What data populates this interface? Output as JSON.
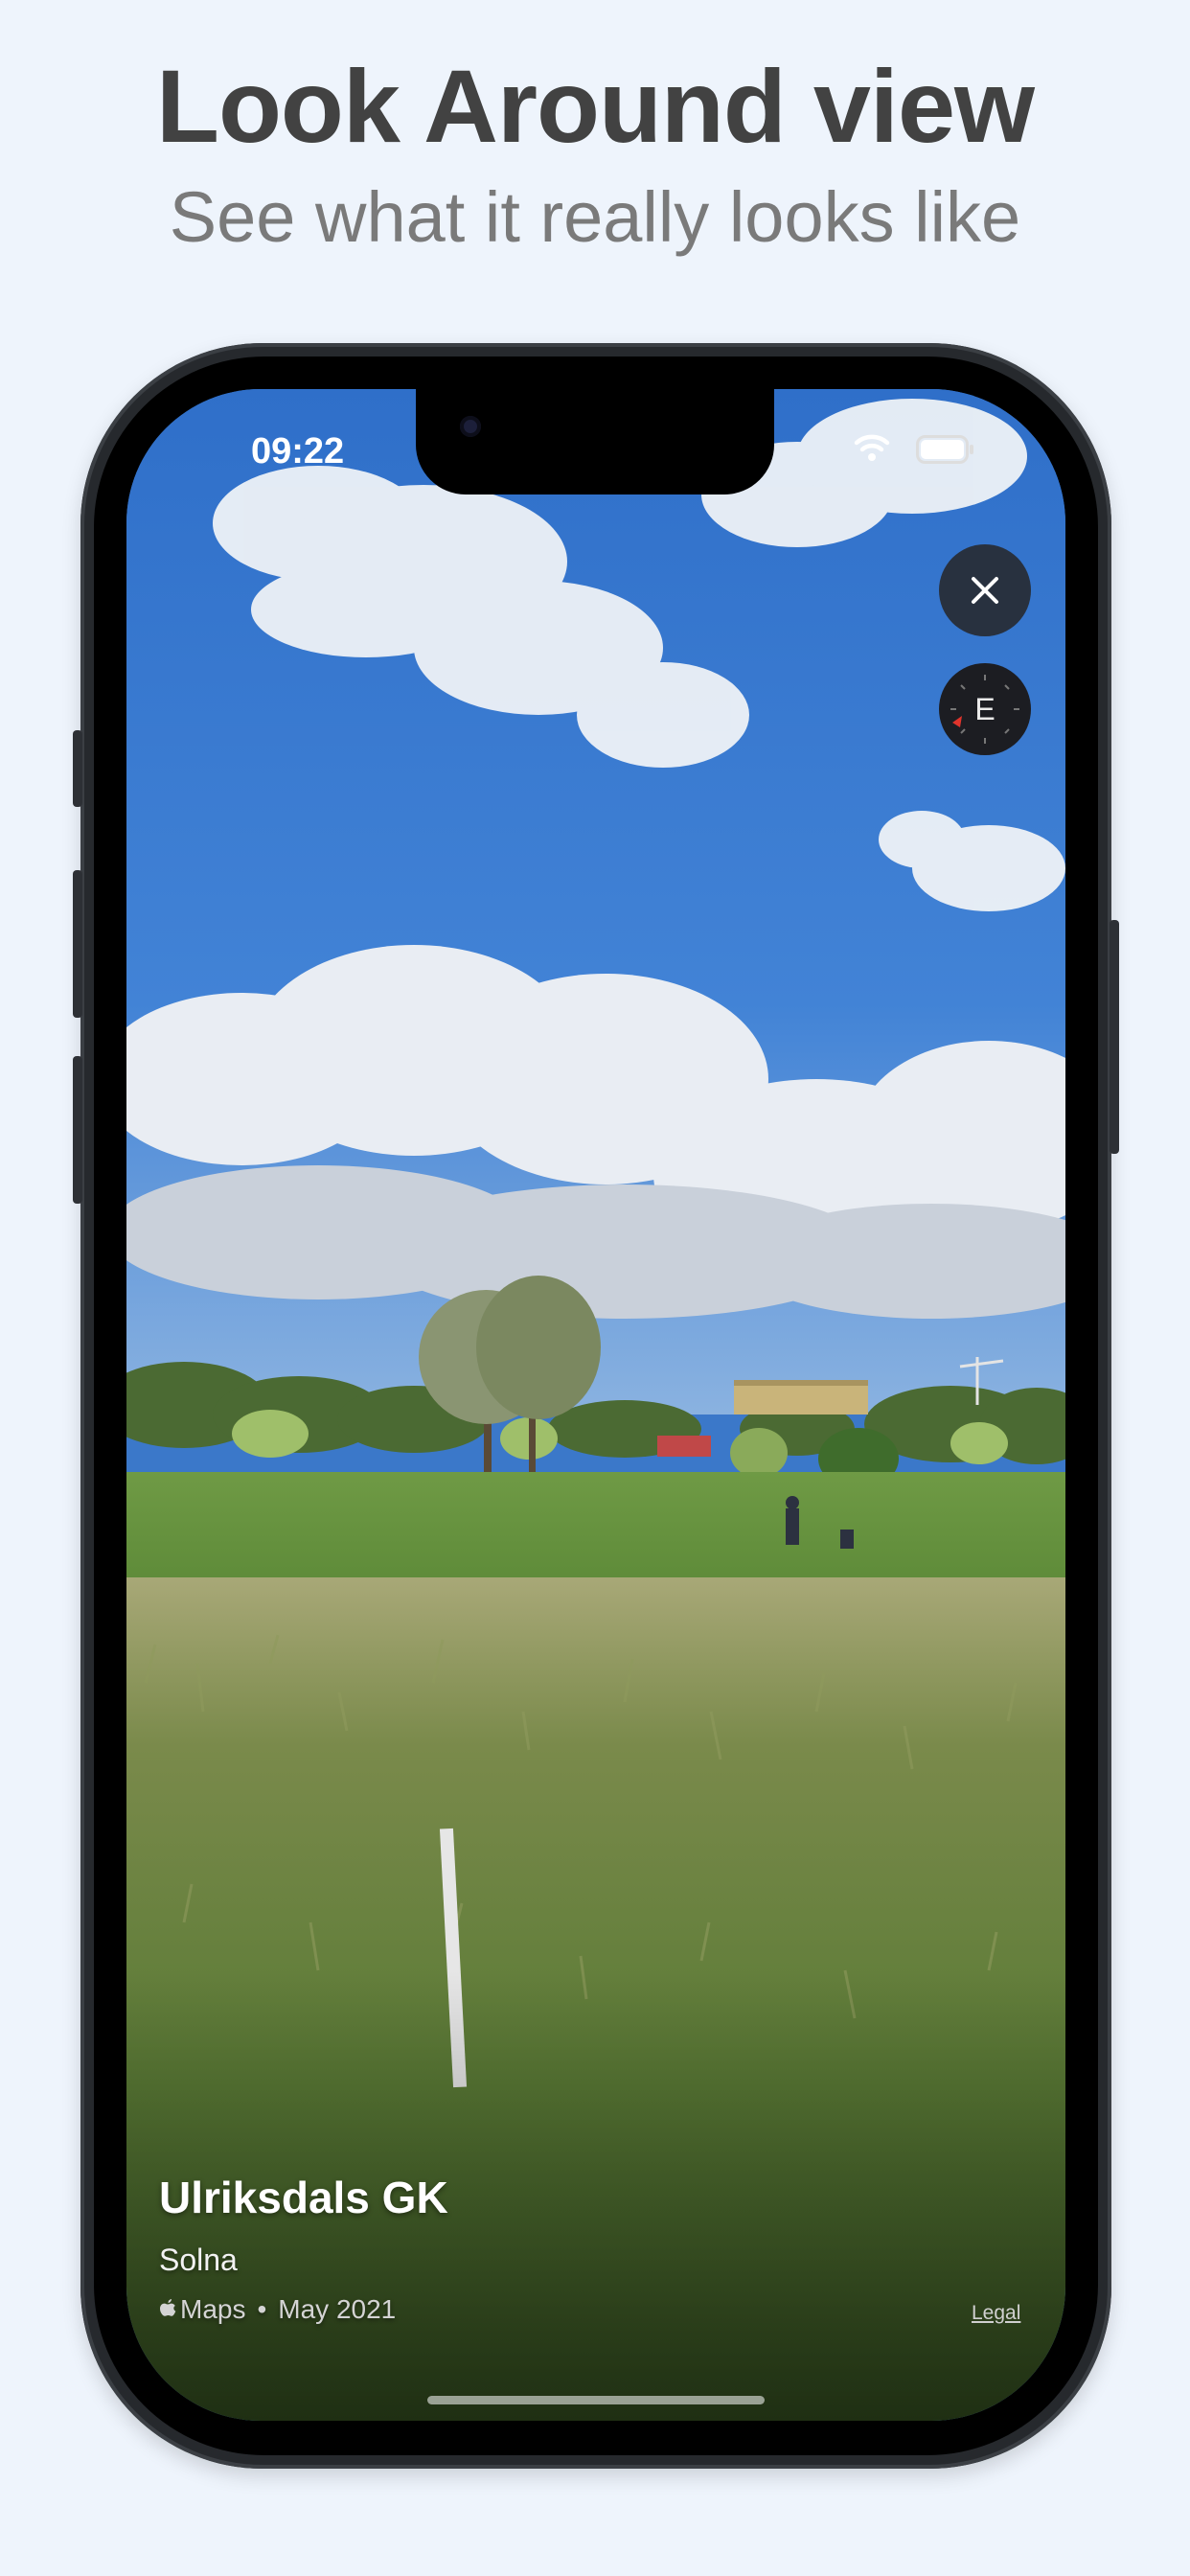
{
  "promo": {
    "title": "Look Around view",
    "subtitle": "See what it really looks like"
  },
  "status_bar": {
    "time": "09:22",
    "wifi_icon": "wifi-icon",
    "battery_icon": "battery-icon"
  },
  "controls": {
    "close_icon": "close-icon",
    "compass_heading": "E"
  },
  "location": {
    "name": "Ulriksdals GK",
    "city": "Solna",
    "source": "Maps",
    "separator": "•",
    "date": "May 2021",
    "legal_label": "Legal"
  },
  "colors": {
    "background": "#eef4fc",
    "sky": "#3b78c9",
    "control_bg": "#28313f",
    "compass_marker": "#e0342c"
  }
}
